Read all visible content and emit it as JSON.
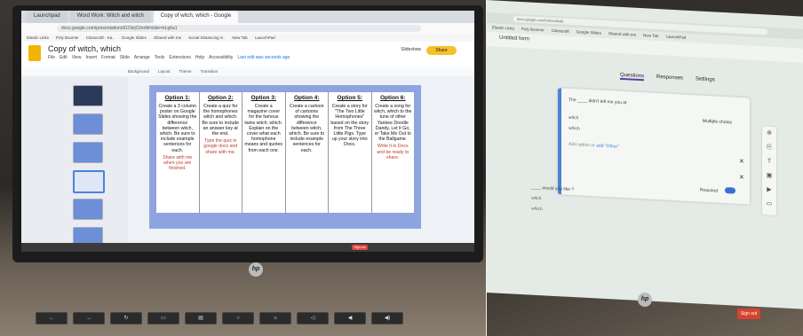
{
  "left_photo": {
    "browser_tabs": [
      "Launchpad",
      "Word Work: Witch and witch",
      "Copy of witch, which - Google"
    ],
    "url": "docs.google.com/presentation/d/1OlzjCt/edit#slide=id.g6a1",
    "bookmarks": [
      "Elastic Links",
      "Poly Boomer",
      "Classcraft - Ka..",
      "Google Slides",
      "Shared with me",
      "Social Distancing S..",
      "New Tab",
      "LaunchPad"
    ],
    "doc_title": "Copy of witch, which",
    "menu": [
      "File",
      "Edit",
      "View",
      "Insert",
      "Format",
      "Slide",
      "Arrange",
      "Tools",
      "Extensions",
      "Help",
      "Accessibility",
      "Last edit was seconds ago"
    ],
    "toolbar": [
      "Background",
      "Layout",
      "Theme",
      "Transition"
    ],
    "slideshow_label": "Slideshow",
    "share_label": "Share",
    "options": [
      {
        "title": "Option 1:",
        "text": "Create a 3 column poster on Google Slides showing the difference between witch, which. Be sure to include example sentences for each.",
        "note": "Share with me when you are finished."
      },
      {
        "title": "Option 2:",
        "text": "Create a quiz for the homophones witch and which. Be sure to include an answer key at the end.",
        "note": "Type the quiz in google docs and share with me."
      },
      {
        "title": "Option 3:",
        "text": "Create a magazine cover for the famous twins witch, which. Explain on the cover what each homophone means and quotes from each one.",
        "note": ""
      },
      {
        "title": "Option 4:",
        "text": "Create a cartoon of cartoons showing the difference between witch, which. Be sure to include example sentences for each.",
        "note": ""
      },
      {
        "title": "Option 5:",
        "text": "Create a story for \"The Two Little Homophones\" based on the story from The Three Little Pigs. Type up your story into Docs.",
        "note": ""
      },
      {
        "title": "Option 6:",
        "text": "Create a song for witch, which to the tune of other Yankee Doodle Dandy, Let It Go, or Take Me Out to the Ballgame.",
        "note": "Write it in Docs and be ready to share."
      }
    ],
    "sign_out": "Sign out",
    "laptop_brand": "hp"
  },
  "right_photo": {
    "url": "docs.google.com/forms/d/edit",
    "bookmarks": [
      "Elastic Links",
      "Poly Boomer",
      "Classcraft",
      "Google Slides",
      "Shared with me",
      "New Tab",
      "LaunchPad"
    ],
    "form_title": "Untitled form",
    "tabs": [
      "Questions",
      "Responses",
      "Settings"
    ],
    "question": "The ____ didn't tell me you at",
    "question_type": "Multiple choice",
    "options": [
      "witch",
      "which"
    ],
    "add_option": "Add option or ",
    "add_other": "add \"Other\"",
    "required": "Required",
    "question2": "____ would you like ?",
    "question2_options": [
      "witch",
      "which"
    ],
    "sign_out": "Sign out",
    "laptop_brand": "hp"
  }
}
